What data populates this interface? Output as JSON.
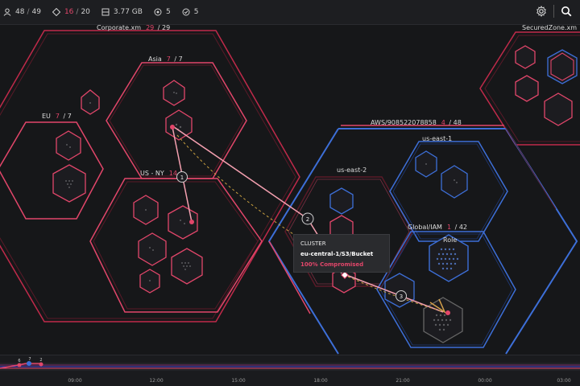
{
  "topbar": {
    "stats": [
      {
        "icon": "users-icon",
        "value": "48",
        "total": "49"
      },
      {
        "icon": "diamond-icon",
        "value": "16",
        "total": "20"
      },
      {
        "icon": "storage-icon",
        "value": "3.77 GB"
      },
      {
        "icon": "target-icon",
        "value": "5"
      },
      {
        "icon": "check-circle-icon",
        "value": "5"
      }
    ],
    "settings_icon": "gear-icon",
    "search_icon": "search-icon"
  },
  "clusters": {
    "corporate": {
      "label": "Corporate.xm",
      "compromised": "29",
      "total": "29"
    },
    "asia": {
      "label": "Asia",
      "compromised": "7",
      "total": "7"
    },
    "eu": {
      "label": "EU",
      "compromised": "7",
      "total": "7"
    },
    "usny": {
      "label": "US - NY",
      "compromised": "14",
      "total": ""
    },
    "securedzone": {
      "label": "SecuredZone.xm"
    },
    "aws": {
      "label": "AWS/908522078858",
      "compromised": "4",
      "total": "48"
    },
    "useast2": {
      "label": "us-east-2"
    },
    "useast1": {
      "label": "us-east-1"
    },
    "globaliam": {
      "label": "Global/IAM",
      "compromised": "1",
      "total": "42"
    },
    "role": {
      "label": "Role"
    }
  },
  "path_steps": [
    "1",
    "2",
    "3"
  ],
  "tooltip": {
    "title": "CLUSTER",
    "path": "eu-central-1/S3/Bucket",
    "status": "100% Compromised"
  },
  "timeline": {
    "ticks": [
      "09:00",
      "12:00",
      "15:00",
      "18:00",
      "21:00",
      "00:00",
      "03:00"
    ],
    "markers": [
      "6",
      "7",
      "2"
    ]
  },
  "colors": {
    "compromised": "#e2466a",
    "safe": "#3d6fd8",
    "path": "#f4a0b0",
    "background": "#161719"
  }
}
